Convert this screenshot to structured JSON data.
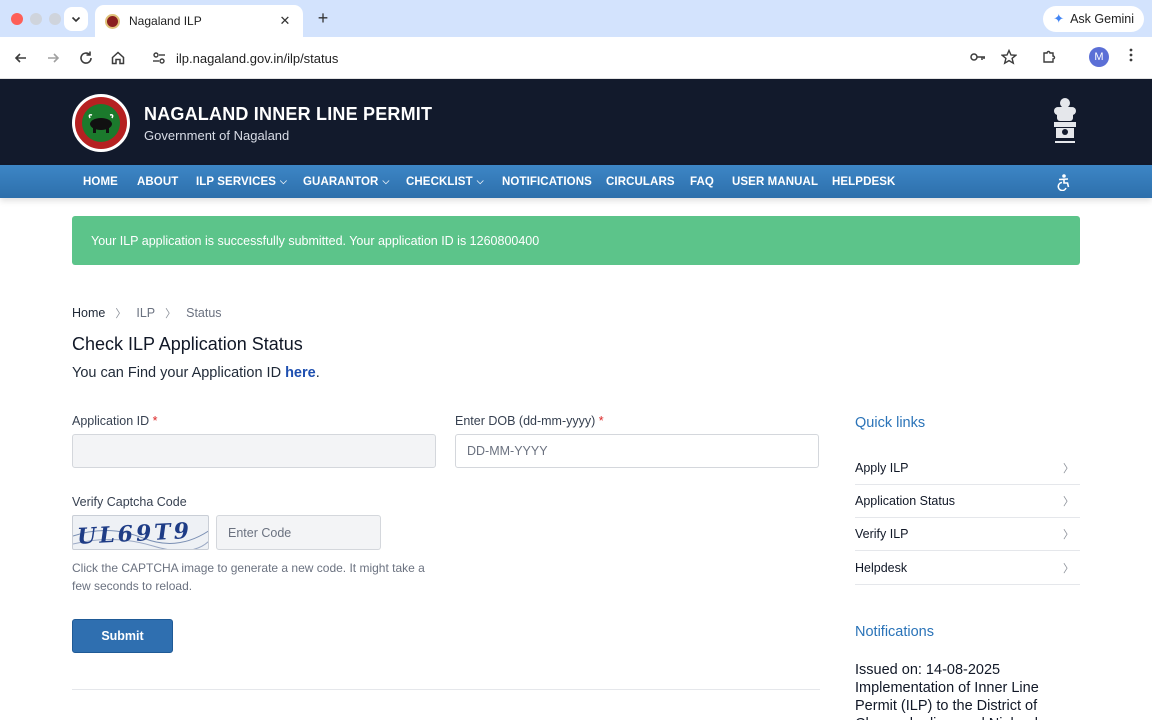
{
  "browser": {
    "tab_title": "Nagaland ILP",
    "url": "ilp.nagaland.gov.in/ilp/status",
    "gemini_label": "Ask Gemini",
    "avatar_letter": "M"
  },
  "header": {
    "title": "NAGALAND INNER LINE PERMIT",
    "subtitle": "Government of Nagaland"
  },
  "nav": {
    "items": [
      {
        "label": "HOME"
      },
      {
        "label": "ABOUT"
      },
      {
        "label": "ILP SERVICES"
      },
      {
        "label": "GUARANTOR"
      },
      {
        "label": "CHECKLIST"
      },
      {
        "label": "NOTIFICATIONS"
      },
      {
        "label": "CIRCULARS"
      },
      {
        "label": "FAQ"
      },
      {
        "label": "USER MANUAL"
      },
      {
        "label": "HELPDESK"
      }
    ]
  },
  "alert": {
    "message": "Your ILP application is successfully submitted. Your application ID is 1260800400"
  },
  "breadcrumb": [
    "Home",
    "ILP",
    "Status"
  ],
  "page": {
    "title": "Check ILP Application Status",
    "hint_prefix": "You can Find your Application ID",
    "hint_link": "here",
    "hint_suffix": "."
  },
  "form": {
    "app_id_label": "Application ID",
    "app_id_value": "",
    "dob_label": "Enter DOB (dd-mm-yyyy)",
    "dob_placeholder": "DD-MM-YYYY",
    "required_mark": "*",
    "captcha_label": "Verify Captcha Code",
    "captcha_text": "UL69T9",
    "captcha_placeholder": "Enter Code",
    "captcha_help": "Click the CAPTCHA image to generate a new code. It might take a few seconds to reload.",
    "submit_label": "Submit"
  },
  "sidebar": {
    "quick_links_heading": "Quick links",
    "quick_links": [
      {
        "label": "Apply ILP"
      },
      {
        "label": "Application Status"
      },
      {
        "label": "Verify ILP"
      },
      {
        "label": "Helpdesk"
      }
    ],
    "notifications_heading": "Notifications",
    "notification_text": "Issued on: 14-08-2025 Implementation of Inner Line Permit (ILP) to the District of Chumoukedima and Niuland"
  },
  "colors": {
    "header_bg": "#121a2c",
    "nav_bg": "#3d86c6",
    "alert_bg": "#5cc48a",
    "accent": "#2a73b8",
    "submit_bg": "#2f6fb0"
  }
}
